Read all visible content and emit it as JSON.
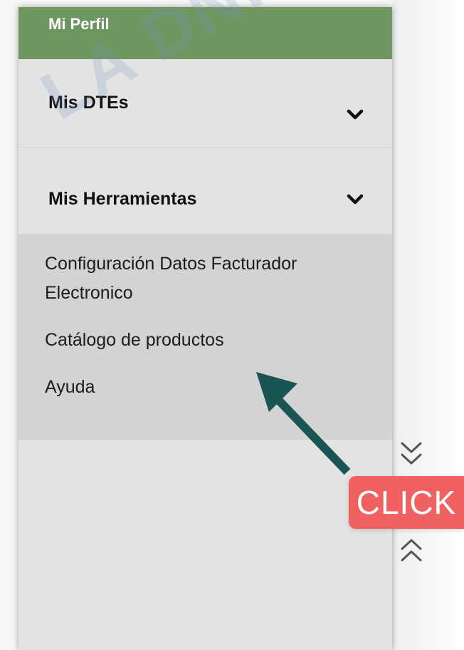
{
  "watermark": "LA DNIT",
  "sidebar": {
    "profile_label": "Mi Perfil",
    "sections": [
      {
        "label": "Mis DTEs",
        "icon": "chevron-down-icon"
      },
      {
        "label": "Mis Herramientas",
        "icon": "chevron-down-icon"
      }
    ],
    "submenu": [
      {
        "label": "Configuración Datos Facturador Electronico"
      },
      {
        "label": "Catálogo de productos"
      },
      {
        "label": "Ayuda"
      }
    ]
  },
  "annotation": {
    "badge_text": "CLICK",
    "badge_color": "#f06262",
    "arrow_color": "#1b5553"
  },
  "scroll": {
    "down_icon": "double-chevron-down-icon",
    "up_icon": "double-chevron-up-icon"
  },
  "colors": {
    "header_green": "#6d9661",
    "sidebar_bg": "#e4e3e4",
    "submenu_bg": "#d3d3d3"
  }
}
